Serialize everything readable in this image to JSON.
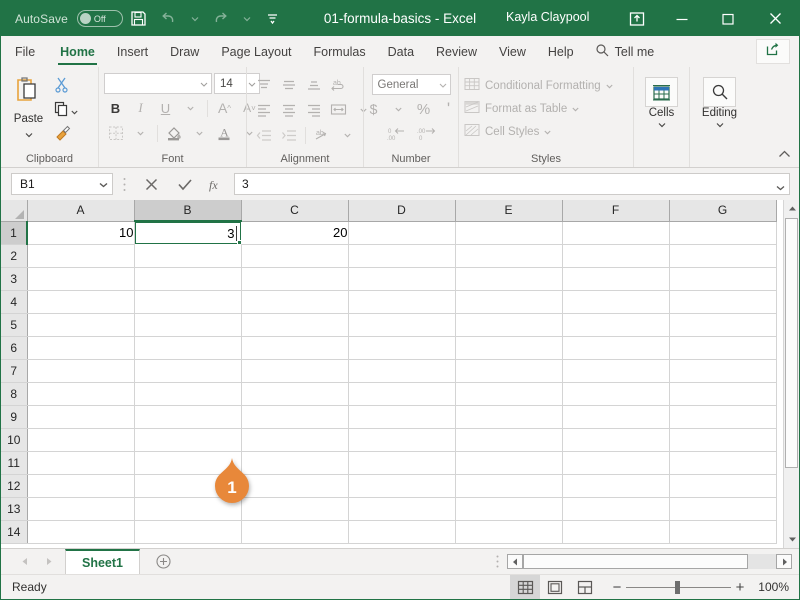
{
  "titlebar": {
    "autosave_label": "AutoSave",
    "autosave_state": "Off",
    "save_icon": "save-icon",
    "undo_icon": "undo-icon",
    "redo_icon": "redo-icon",
    "customize_qat_icon": "customize-quick-access-toolbar-icon",
    "document_title": "01-formula-basics  -  Excel",
    "user_name": "Kayla Claypool",
    "ribbon_display_icon": "ribbon-display-options-icon",
    "minimize_icon": "minimize-icon",
    "maximize_icon": "maximize-icon",
    "close_icon": "close-icon",
    "bg_color": "#217346"
  },
  "tabs": [
    {
      "label": "File",
      "active": false
    },
    {
      "label": "Home",
      "active": true
    },
    {
      "label": "Insert",
      "active": false
    },
    {
      "label": "Draw",
      "active": false
    },
    {
      "label": "Page Layout",
      "active": false
    },
    {
      "label": "Formulas",
      "active": false
    },
    {
      "label": "Data",
      "active": false
    },
    {
      "label": "Review",
      "active": false
    },
    {
      "label": "View",
      "active": false
    },
    {
      "label": "Help",
      "active": false
    }
  ],
  "tellme": {
    "label": "Tell me",
    "icon": "search-icon"
  },
  "share": {
    "icon": "share-icon"
  },
  "ribbon": {
    "clipboard": {
      "label": "Clipboard",
      "paste_label": "Paste",
      "paste_icon": "paste-icon",
      "cut_icon": "cut-scissors-icon",
      "copy_icon": "copy-icon",
      "format_painter_icon": "format-painter-icon"
    },
    "font": {
      "label": "Font",
      "font_name": "",
      "font_size": "14",
      "bold_label": "B",
      "italic_label": "I",
      "underline_label": "U",
      "grow_font_label": "A",
      "shrink_font_label": "A",
      "borders_icon": "borders-icon",
      "fill_color_icon": "fill-color-icon",
      "font_color_icon": "font-color-icon"
    },
    "alignment": {
      "label": "Alignment",
      "align_top_icon": "align-top-icon",
      "align_middle_icon": "align-middle-icon",
      "align_bottom_icon": "align-bottom-icon",
      "wrap_text_icon": "wrap-text-icon",
      "align_left_icon": "align-left-icon",
      "align_center_icon": "align-center-icon",
      "align_right_icon": "align-right-icon",
      "merge_cells_icon": "merge-and-center-icon",
      "decrease_indent_icon": "decrease-indent-icon",
      "increase_indent_icon": "increase-indent-icon",
      "orientation_icon": "orientation-icon"
    },
    "number": {
      "label": "Number",
      "format": "General",
      "currency_label": "$",
      "percent_label": "%",
      "comma_label": "'",
      "decrease_decimal_icon": "decrease-decimal-icon",
      "increase_decimal_icon": "increase-decimal-icon"
    },
    "styles": {
      "label": "Styles",
      "items": [
        {
          "label": "Conditional Formatting",
          "icon": "conditional-formatting-icon"
        },
        {
          "label": "Format as Table",
          "icon": "format-as-table-icon"
        },
        {
          "label": "Cell Styles",
          "icon": "cell-styles-icon"
        }
      ]
    },
    "cells": {
      "label": "Cells",
      "icon": "cells-icon"
    },
    "editing": {
      "label": "Editing",
      "icon": "find-select-icon"
    },
    "collapse_icon": "collapse-ribbon-icon"
  },
  "formulabar": {
    "name_box": "B1",
    "name_box_arrow_icon": "chevron-down-icon",
    "cancel_icon": "cancel-x-icon",
    "enter_icon": "enter-checkmark-icon",
    "function_icon": "insert-function-fx-icon",
    "formula_value": "3",
    "expand_icon": "expand-formula-bar-icon"
  },
  "grid": {
    "columns": [
      "A",
      "B",
      "C",
      "D",
      "E",
      "F",
      "G"
    ],
    "selected_column": "B",
    "selected_row": "1",
    "rows": [
      "1",
      "2",
      "3",
      "4",
      "5",
      "6",
      "7",
      "8",
      "9",
      "10",
      "11",
      "12",
      "13",
      "14"
    ],
    "cells": {
      "A1": "10",
      "B1": "3",
      "C1": "20"
    },
    "editing_cell": "B1",
    "editing_value": "3"
  },
  "marker": {
    "number": "1",
    "color": "#e8883a"
  },
  "sheetbar": {
    "prev_icon": "previous-sheet-icon",
    "next_icon": "next-sheet-icon",
    "sheets": [
      "Sheet1"
    ],
    "active_sheet": "Sheet1",
    "add_sheet_icon": "add-sheet-plus-icon",
    "context_dots_icon": "sheet-options-dots-icon"
  },
  "statusbar": {
    "status": "Ready",
    "normal_view_icon": "normal-view-icon",
    "page_layout_icon": "page-layout-view-icon",
    "page_break_icon": "page-break-preview-icon",
    "zoom_out_label": "−",
    "zoom_in_label": "+",
    "zoom_level": "100%"
  }
}
